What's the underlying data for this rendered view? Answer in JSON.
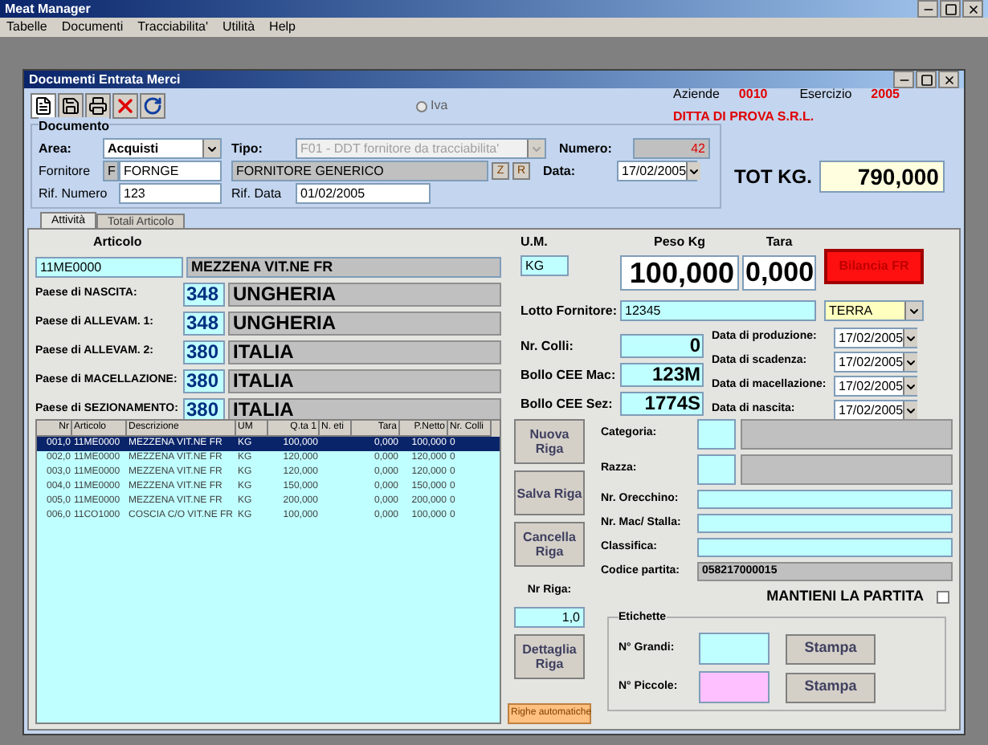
{
  "app": {
    "title": "Meat Manager"
  },
  "menu": [
    "Tabelle",
    "Documenti",
    "Tracciabilita'",
    "Utilità",
    "Help"
  ],
  "window": {
    "title": "Documenti Entrata Merci"
  },
  "iva": {
    "label": "Iva",
    "selected": false
  },
  "company": {
    "aziende_label": "Aziende",
    "aziende": "0010",
    "esercizio_label": "Esercizio",
    "esercizio": "2005",
    "name": "DITTA DI PROVA S.R.L."
  },
  "documento": {
    "title": "Documento",
    "area_label": "Area:",
    "area": "Acquisti",
    "tipo_label": "Tipo:",
    "tipo": "F01 - DDT fornitore da tracciabilita'",
    "numero_label": "Numero:",
    "numero": "42",
    "fornitore_label": "Fornitore",
    "fornitore_type": "F",
    "fornitore_code": "FORNGE",
    "fornitore_name": "FORNITORE GENERICO",
    "buttons": [
      "Z",
      "R"
    ],
    "data_label": "Data:",
    "data": "17/02/2005",
    "rif_numero_label": "Rif. Numero",
    "rif_numero": "123",
    "rif_data_label": "Rif. Data",
    "rif_data": "01/02/2005"
  },
  "total": {
    "label": "TOT KG.",
    "value": "790,000"
  },
  "tabs": [
    {
      "label": "Attività",
      "selected": true
    },
    {
      "label": "Totali Articolo",
      "selected": false
    }
  ],
  "articolo": {
    "label": "Articolo",
    "code": "11ME0000",
    "name": "MEZZENA VIT.NE FR"
  },
  "countries": [
    {
      "label": "Paese di NASCITA:",
      "code": "348",
      "name": "UNGHERIA"
    },
    {
      "label": "Paese di ALLEVAM. 1:",
      "code": "348",
      "name": "UNGHERIA"
    },
    {
      "label": "Paese di ALLEVAM. 2:",
      "code": "380",
      "name": "ITALIA"
    },
    {
      "label": "Paese di MACELLAZIONE:",
      "code": "380",
      "name": "ITALIA"
    },
    {
      "label": "Paese di SEZIONAMENTO:",
      "code": "380",
      "name": "ITALIA"
    }
  ],
  "um": {
    "label": "U.M.",
    "value": "KG"
  },
  "peso": {
    "label": "Peso Kg",
    "value": "100,000"
  },
  "tara": {
    "label": "Tara",
    "value": "0,000"
  },
  "scale_button": "Bilancia FR",
  "lotto": {
    "label": "Lotto Fornitore:",
    "value": "12345",
    "origin": "TERRA"
  },
  "middle_fields": [
    {
      "label": "Nr. Colli:",
      "value": "0"
    },
    {
      "label": "Bollo CEE Mac:",
      "value": "123M"
    },
    {
      "label": "Bollo CEE Sez:",
      "value": "1774S"
    }
  ],
  "dates": [
    {
      "label": "Data di produzione:",
      "value": "17/02/2005"
    },
    {
      "label": "Data di scadenza:",
      "value": "17/02/2005"
    },
    {
      "label": "Data di macellazione:",
      "value": "17/02/2005"
    },
    {
      "label": "Data di nascita:",
      "value": "17/02/2005"
    }
  ],
  "table": {
    "columns": [
      "Nr",
      "Articolo",
      "Descrizione",
      "UM",
      "Q.ta 1",
      "N. eti",
      "Tara",
      "P.Netto",
      "Nr. Colli"
    ],
    "rows": [
      {
        "cells": [
          "001,0",
          "11ME0000",
          "MEZZENA VIT.NE FR",
          "KG",
          "100,000",
          "",
          "0,000",
          "100,000",
          "0"
        ],
        "selected": true
      },
      {
        "cells": [
          "002,0",
          "11ME0000",
          "MEZZENA VIT.NE FR",
          "KG",
          "120,000",
          "",
          "0,000",
          "120,000",
          "0"
        ],
        "selected": false
      },
      {
        "cells": [
          "003,0",
          "11ME0000",
          "MEZZENA VIT.NE FR",
          "KG",
          "120,000",
          "",
          "0,000",
          "120,000",
          "0"
        ],
        "selected": false
      },
      {
        "cells": [
          "004,0",
          "11ME0000",
          "MEZZENA VIT.NE FR",
          "KG",
          "150,000",
          "",
          "0,000",
          "150,000",
          "0"
        ],
        "selected": false
      },
      {
        "cells": [
          "005,0",
          "11ME0000",
          "MEZZENA VIT.NE FR",
          "KG",
          "200,000",
          "",
          "0,000",
          "200,000",
          "0"
        ],
        "selected": false
      },
      {
        "cells": [
          "006,0",
          "11CO1000",
          "COSCIA C/O VIT.NE FR",
          "KG",
          "100,000",
          "",
          "0,000",
          "100,000",
          "0"
        ],
        "selected": false
      }
    ]
  },
  "row_buttons": [
    "Nuova Riga",
    "Salva Riga",
    "Cancella Riga"
  ],
  "nr_riga": {
    "label": "Nr Riga:",
    "value": "1,0"
  },
  "dettaglia": "Dettaglia Riga",
  "auto_button": "Righe automatiche",
  "details": [
    {
      "kind": "pair",
      "label": "Categoria:"
    },
    {
      "kind": "pair",
      "label": "Razza:"
    },
    {
      "kind": "field",
      "label": "Nr. Orecchino:"
    },
    {
      "kind": "field",
      "label": "Nr. Mac/ Stalla:"
    },
    {
      "kind": "field",
      "label": "Classifica:"
    },
    {
      "kind": "readonly",
      "label": "Codice partita:",
      "value": "058217000015"
    }
  ],
  "mantieni": {
    "label": "MANTIENI LA PARTITA",
    "checked": false
  },
  "etichette": {
    "title": "Etichette",
    "rows": [
      {
        "label": "N° Grandi:",
        "color": "#c0ffff",
        "button": "Stampa"
      },
      {
        "label": "N° Piccole:",
        "color": "#ffc0ff",
        "button": "Stampa"
      }
    ]
  }
}
